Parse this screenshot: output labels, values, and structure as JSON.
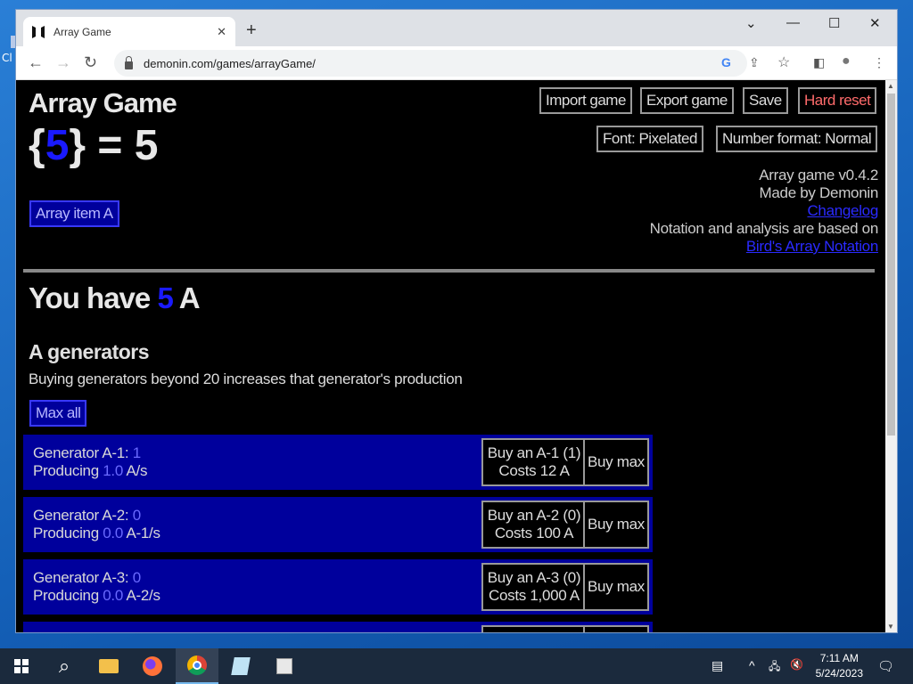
{
  "desktop": {
    "label": "Cl"
  },
  "browser": {
    "tab_title": "Array Game",
    "tab_close": "✕",
    "new_tab": "+",
    "url": "demonin.com/games/arrayGame/",
    "controls": {
      "dropdown": "⌄",
      "minimize": "—",
      "maximize": "☐",
      "close": "✕"
    },
    "nav": {
      "back": "←",
      "forward": "→",
      "reload": "↻"
    },
    "toolbar_icons": {
      "google": "G",
      "share": "⇪",
      "star": "☆",
      "sidebar": "◧",
      "profile": "●",
      "menu": "⋮"
    }
  },
  "game": {
    "title": "Array Game",
    "equation": {
      "open": "{",
      "value": "5",
      "close": "} = 5"
    },
    "buttons": {
      "import": "Import game",
      "export": "Export game",
      "save": "Save",
      "hard_reset": "Hard reset",
      "font": "Font: Pixelated",
      "number_format": "Number format: Normal",
      "array_item": "Array item A",
      "max_all": "Max all"
    },
    "meta": {
      "version": "Array game v0.4.2",
      "author": "Made by Demonin",
      "changelog": "Changelog",
      "notation_note": "Notation and analysis are based on",
      "notation_link": "Bird's Array Notation"
    },
    "you_have": {
      "prefix": "You have",
      "amount": "5",
      "unit": "A"
    },
    "generators_heading": "A generators",
    "generators_note": "Buying generators beyond 20 increases that generator's production",
    "generators": [
      {
        "name": "Generator A-1: ",
        "count": "1",
        "producing_label": "Producing ",
        "rate": "1.0",
        "unit": " A/s",
        "buy_line1": "Buy an A-1 (1)",
        "buy_line2": "Costs 12 A",
        "max": "Buy max"
      },
      {
        "name": "Generator A-2: ",
        "count": "0",
        "producing_label": "Producing ",
        "rate": "0.0",
        "unit": " A-1/s",
        "buy_line1": "Buy an A-2 (0)",
        "buy_line2": "Costs 100 A",
        "max": "Buy max"
      },
      {
        "name": "Generator A-3: ",
        "count": "0",
        "producing_label": "Producing ",
        "rate": "0.0",
        "unit": " A-2/s",
        "buy_line1": "Buy an A-3 (0)",
        "buy_line2": "Costs 1,000 A",
        "max": "Buy max"
      }
    ]
  },
  "taskbar": {
    "time": "7:11 AM",
    "date": "5/24/2023",
    "search_icon": "⌕",
    "tray": {
      "news": "▤",
      "chevron": "^",
      "network": "🖧",
      "volume": "🔇",
      "notifications": "🗨"
    }
  }
}
